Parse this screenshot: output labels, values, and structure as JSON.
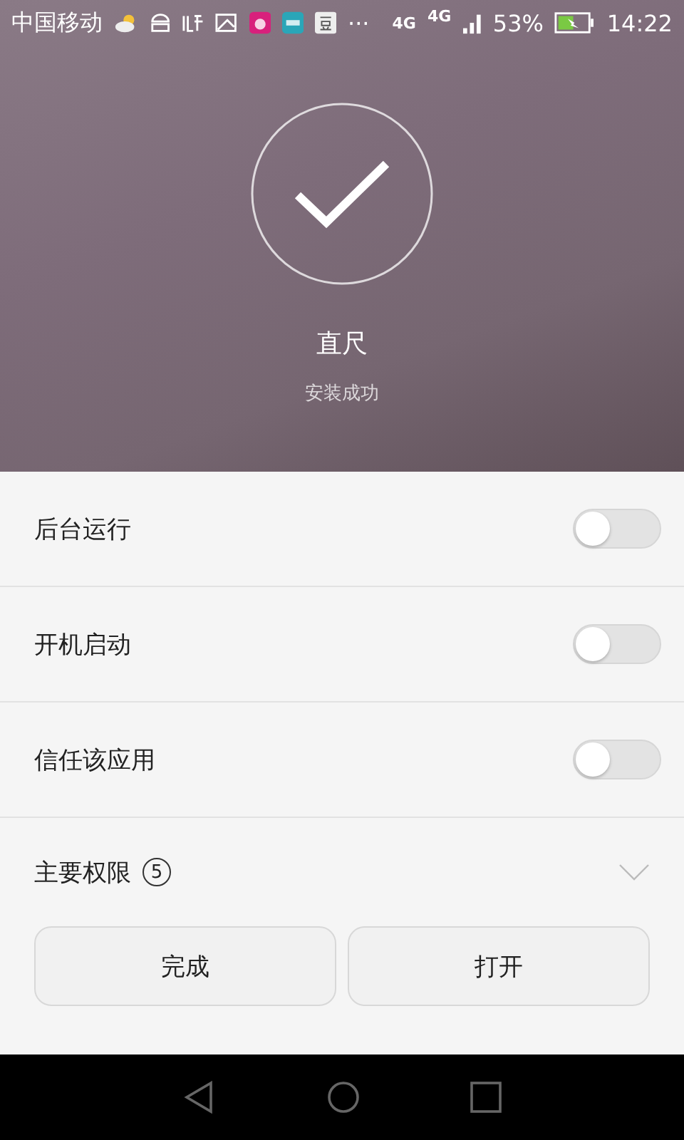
{
  "status_bar": {
    "carrier": "中国移动",
    "more": "···",
    "network": [
      "4G",
      "4G"
    ],
    "battery": {
      "percent": "53%",
      "charging": true
    },
    "time": "14:22"
  },
  "header": {
    "app_name": "直尺",
    "message": "安装成功"
  },
  "settings": [
    {
      "label": "后台运行",
      "on": false
    },
    {
      "label": "开机启动",
      "on": false
    },
    {
      "label": "信任该应用",
      "on": false
    }
  ],
  "permissions": {
    "label": "主要权限",
    "count": "5",
    "expanded": false
  },
  "buttons": [
    {
      "label": "完成"
    },
    {
      "label": "打开"
    }
  ]
}
